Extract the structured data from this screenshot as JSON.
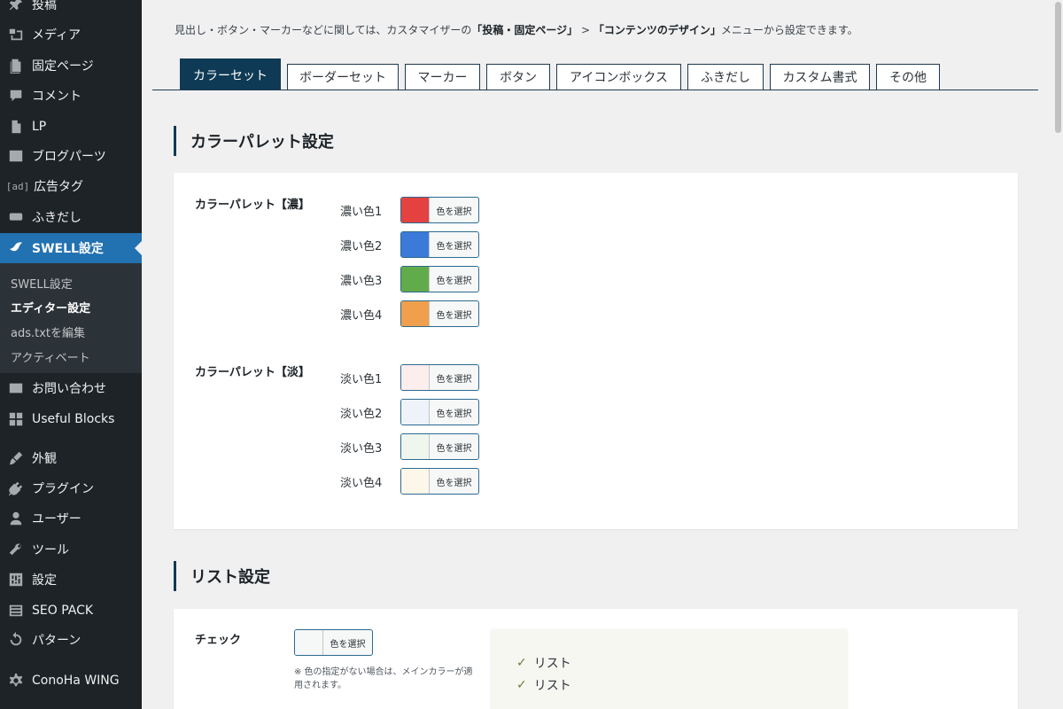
{
  "sidebar": {
    "items": [
      {
        "label": "投稿",
        "icon": "pin-icon"
      },
      {
        "label": "メディア",
        "icon": "media-icon"
      },
      {
        "label": "固定ページ",
        "icon": "page-icon"
      },
      {
        "label": "コメント",
        "icon": "comment-icon"
      },
      {
        "label": "LP",
        "icon": "document-icon"
      },
      {
        "label": "ブログパーツ",
        "icon": "table-icon"
      },
      {
        "label": "広告タグ",
        "icon": "ad-icon",
        "icon_text": "[ad]"
      },
      {
        "label": "ふきだし",
        "icon": "bubble-icon"
      },
      {
        "label": "SWELL設定",
        "icon": "swell-icon"
      },
      {
        "label": "お問い合わせ",
        "icon": "mail-icon"
      },
      {
        "label": "Useful Blocks",
        "icon": "grid-icon"
      },
      {
        "label": "外観",
        "icon": "brush-icon"
      },
      {
        "label": "プラグイン",
        "icon": "plugin-icon"
      },
      {
        "label": "ユーザー",
        "icon": "user-icon"
      },
      {
        "label": "ツール",
        "icon": "wrench-icon"
      },
      {
        "label": "設定",
        "icon": "settings-icon"
      },
      {
        "label": "SEO PACK",
        "icon": "list-icon"
      },
      {
        "label": "パターン",
        "icon": "refresh-icon"
      },
      {
        "label": "ConoHa WING",
        "icon": "gear-icon"
      }
    ],
    "submenu": [
      "SWELL設定",
      "エディター設定",
      "ads.txtを編集",
      "アクティベート"
    ]
  },
  "info": {
    "prefix": "見出し・ボタン・マーカーなどに関しては、カスタマイザーの",
    "link1": "「投稿・固定ページ」",
    "sep": " > ",
    "link2": "「コンテンツのデザイン」",
    "suffix": "メニューから設定できます。"
  },
  "tabs": [
    "カラーセット",
    "ボーダーセット",
    "マーカー",
    "ボタン",
    "アイコンボックス",
    "ふきだし",
    "カスタム書式",
    "その他"
  ],
  "palette": {
    "title": "カラーパレット設定",
    "button_label": "色を選択",
    "dark_group": "カラーパレット【濃】",
    "dark": [
      {
        "label": "濃い色1",
        "color": "#e44141"
      },
      {
        "label": "濃い色2",
        "color": "#3c7ad9"
      },
      {
        "label": "濃い色3",
        "color": "#62ab4a"
      },
      {
        "label": "濃い色4",
        "color": "#f0a04d"
      }
    ],
    "light_group": "カラーパレット【淡】",
    "light": [
      {
        "label": "淡い色1",
        "color": "#fdeeee"
      },
      {
        "label": "淡い色2",
        "color": "#eef3fa"
      },
      {
        "label": "淡い色3",
        "color": "#eef6ee"
      },
      {
        "label": "淡い色4",
        "color": "#fdf7ea"
      }
    ]
  },
  "list": {
    "title": "リスト設定",
    "check_label": "チェック",
    "button_label": "色を選択",
    "note": "※ 色の指定がない場合は、メインカラーが適用されます。",
    "preview_items": [
      "リスト",
      "リスト"
    ]
  }
}
